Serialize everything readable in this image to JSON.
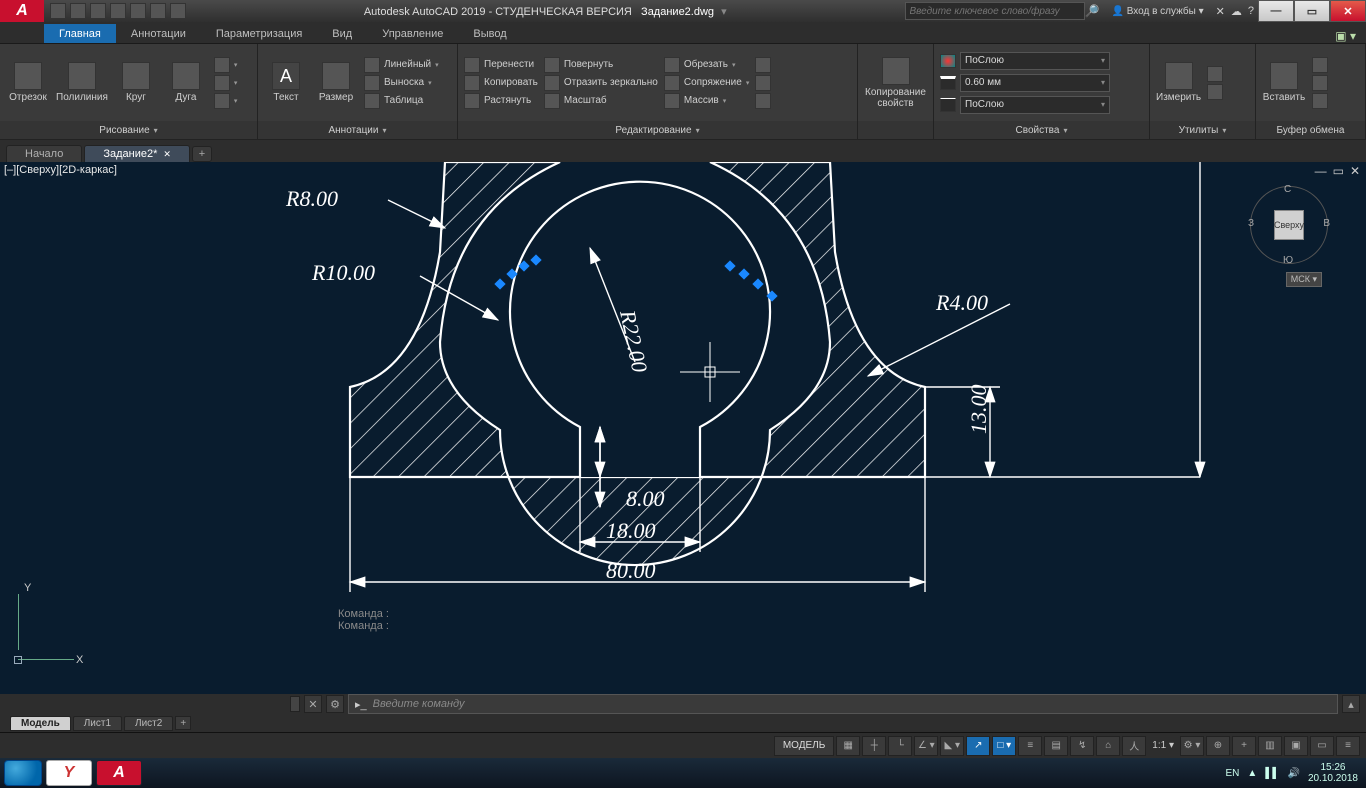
{
  "titlebar": {
    "app": "Autodesk AutoCAD 2019 - СТУДЕНЧЕСКАЯ ВЕРСИЯ",
    "file": "Задание2.dwg",
    "search_placeholder": "Введите ключевое слово/фразу",
    "signin": "Вход в службы"
  },
  "tabs": {
    "items": [
      "Главная",
      "Аннотации",
      "Параметризация",
      "Вид",
      "Управление",
      "Вывод"
    ],
    "active": 0
  },
  "ribbon": {
    "draw": {
      "label": "Рисование",
      "btns": [
        "Отрезок",
        "Полилиния",
        "Круг",
        "Дуга"
      ]
    },
    "annot": {
      "label": "Аннотации",
      "text": "Текст",
      "dim": "Размер",
      "items": [
        "Линейный",
        "Выноска",
        "Таблица"
      ]
    },
    "mod": {
      "label": "Редактирование",
      "left": [
        "Перенести",
        "Копировать",
        "Растянуть"
      ],
      "mid": [
        "Повернуть",
        "Отразить зеркально",
        "Масштаб"
      ],
      "right": [
        "Обрезать",
        "Сопряжение",
        "Массив"
      ]
    },
    "props": {
      "label": "Свойства",
      "layer": "ПоСлою",
      "lw": "0.60 мм",
      "lt": "ПоСлою",
      "copyprops": "Копирование\nсвойств"
    },
    "util": {
      "label": "Утилиты",
      "measure": "Измерить"
    },
    "clip": {
      "label": "Буфер обмена",
      "paste": "Вставить"
    }
  },
  "filetabs": {
    "items": [
      "Начало",
      "Задание2*"
    ],
    "active": 1
  },
  "viewport": {
    "ctrl": "[–][Сверху][2D-каркас]",
    "cube_face": "Сверху",
    "ucs": "МСК",
    "dirs": {
      "n": "С",
      "s": "Ю",
      "e": "В",
      "w": "З"
    },
    "axis": {
      "x": "X",
      "y": "Y"
    }
  },
  "drawing": {
    "dims": {
      "r8": "R8.00",
      "r10": "R10.00",
      "r22": "R22.00",
      "r4": "R4.00",
      "d13": "13.00",
      "d8": "8.00",
      "d18": "18.00",
      "d80": "80.00"
    }
  },
  "cmd": {
    "hist": "Команда :",
    "prompt": "▸_",
    "placeholder": "Введите  команду"
  },
  "layouts": {
    "items": [
      "Модель",
      "Лист1",
      "Лист2"
    ],
    "active": 0
  },
  "status": {
    "model": "МОДЕЛЬ",
    "scale": "1:1"
  },
  "taskbar": {
    "lang": "EN",
    "time": "15:26",
    "date": "20.10.2018"
  }
}
